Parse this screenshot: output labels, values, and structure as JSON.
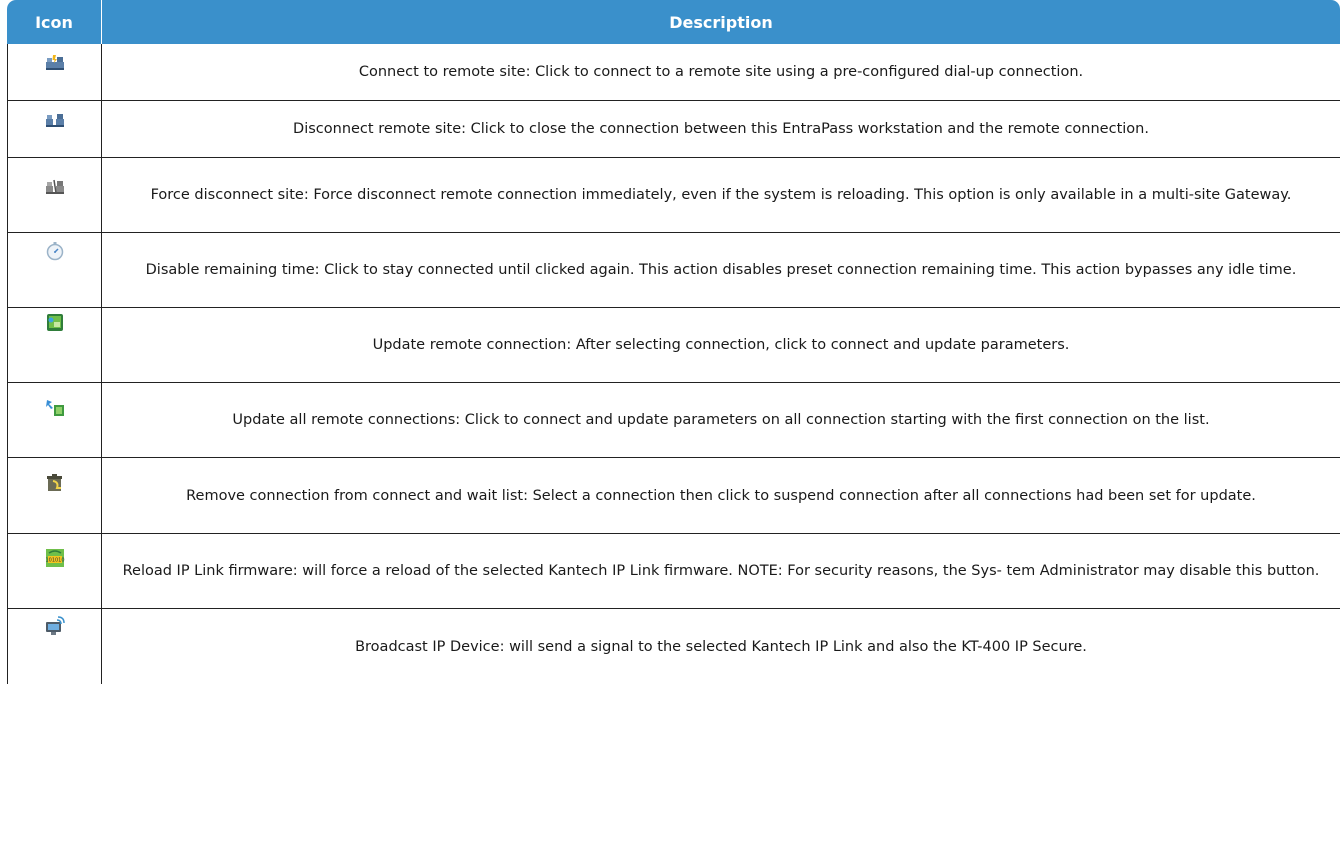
{
  "header": {
    "icon_col": "Icon",
    "desc_col": "Description"
  },
  "rows": [
    {
      "icon": "connect-remote-site-icon",
      "description": "Connect to remote site: Click to connect to a remote site using a pre-configured dial-up connection."
    },
    {
      "icon": "disconnect-remote-site-icon",
      "description": "Disconnect remote site: Click to close the connection between this EntraPass workstation and the remote connection."
    },
    {
      "icon": "force-disconnect-site-icon",
      "description": "Force disconnect site: Force disconnect remote connection immediately, even if the system is reloading. This option is only available in a multi-site Gateway."
    },
    {
      "icon": "stopwatch-icon",
      "description": "Disable remaining time: Click to stay connected until clicked again. This action disables preset connection remaining time. This action bypasses any idle time."
    },
    {
      "icon": "update-remote-connection-icon",
      "description": "Update remote connection: After selecting connection, click to connect and update parameters."
    },
    {
      "icon": "update-all-connections-icon",
      "description": "Update all remote connections: Click to connect and update parameters on all connection starting with the first connection on the list."
    },
    {
      "icon": "remove-from-wait-list-icon",
      "description": "Remove connection from connect and wait list: Select a connection then click to suspend connection after all connections had been set for update."
    },
    {
      "icon": "reload-firmware-icon",
      "description": "Reload IP Link firmware: will force a reload of the selected Kantech IP Link firmware. NOTE: For security reasons, the Sys- tem Administrator may disable this button."
    },
    {
      "icon": "broadcast-ip-device-icon",
      "description": "Broadcast IP Device: will send a signal to the selected Kantech IP Link and also the KT-400 IP Secure."
    }
  ]
}
